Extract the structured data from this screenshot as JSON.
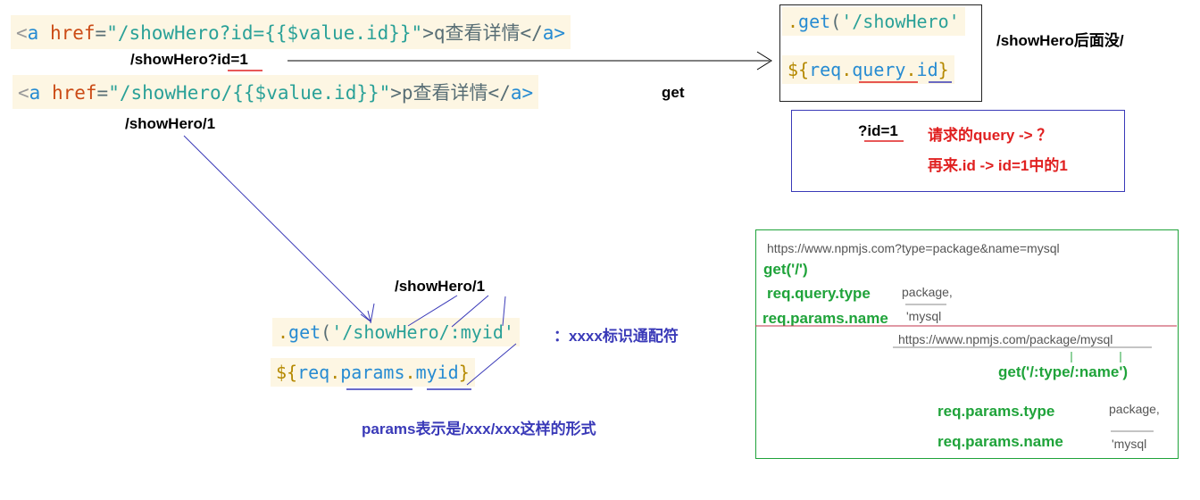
{
  "top_left": {
    "line1": {
      "lt": "<",
      "tag": "a",
      "attr": " href",
      "eq": "=",
      "str": "\"/showHero?id={{$value.id}}\"",
      "text": ">q查看详情</",
      "close": "a>"
    },
    "label1": "/showHero?id=1",
    "line2": {
      "lt": "<",
      "tag": "a",
      "attr": " href",
      "eq": "=",
      "str": "\"/showHero/{{$value.id}}\"",
      "text": ">p查看详情</",
      "close": "a>"
    },
    "label2": "/showHero/1",
    "get_label": "get"
  },
  "top_right": {
    "code1": {
      "dot": ".",
      "fn": "get",
      "open": "(",
      "str": "'/showHero'",
      "trail": ""
    },
    "code2": {
      "dollar": "${",
      "obj": "req",
      "dot1": ".",
      "prop": "query",
      "dot2": ".",
      "key": "id",
      "close": "}"
    },
    "note": "/showHero后面没/",
    "box": {
      "qid": "?id=1",
      "line1": "请求的query ->  ？",
      "line2": "再来.id ->    id=1中的1"
    }
  },
  "middle": {
    "label": "/showHero/1",
    "code1": {
      "dot": ".",
      "fn": "get",
      "open": "(",
      "str": "'/showHero/:myid'"
    },
    "code2": {
      "dollar": "${",
      "obj": "req",
      "dot1": ".",
      "prop": "params",
      "dot2": ".",
      "key": "myid",
      "close": "}"
    },
    "wildcard_note": "：xxxx标识通配符",
    "params_note": "params表示是/xxx/xxx这样的形式"
  },
  "green_box": {
    "url1": "https://www.npmjs.com?type=package&name=mysql",
    "get1": "get('/')",
    "rq_type": "req.query.type",
    "rq_type_val": "package,",
    "rp_name": "req.params.name",
    "rp_name_val": "'mysql",
    "url2": "https://www.npmjs.com/package/mysql",
    "get2": "get('/:type/:name')",
    "rp_type2": "req.params.type",
    "rp_type2_val": "package,",
    "rp_name2": "req.params.name",
    "rp_name2_val": "'mysql"
  },
  "colors": {
    "code_bg": "#fdf6e3",
    "red": "#e02020",
    "purple": "#3a3ab8",
    "green": "#1fa33a",
    "box_blue": "#3a3ab8",
    "box_green": "#1fa33a"
  }
}
